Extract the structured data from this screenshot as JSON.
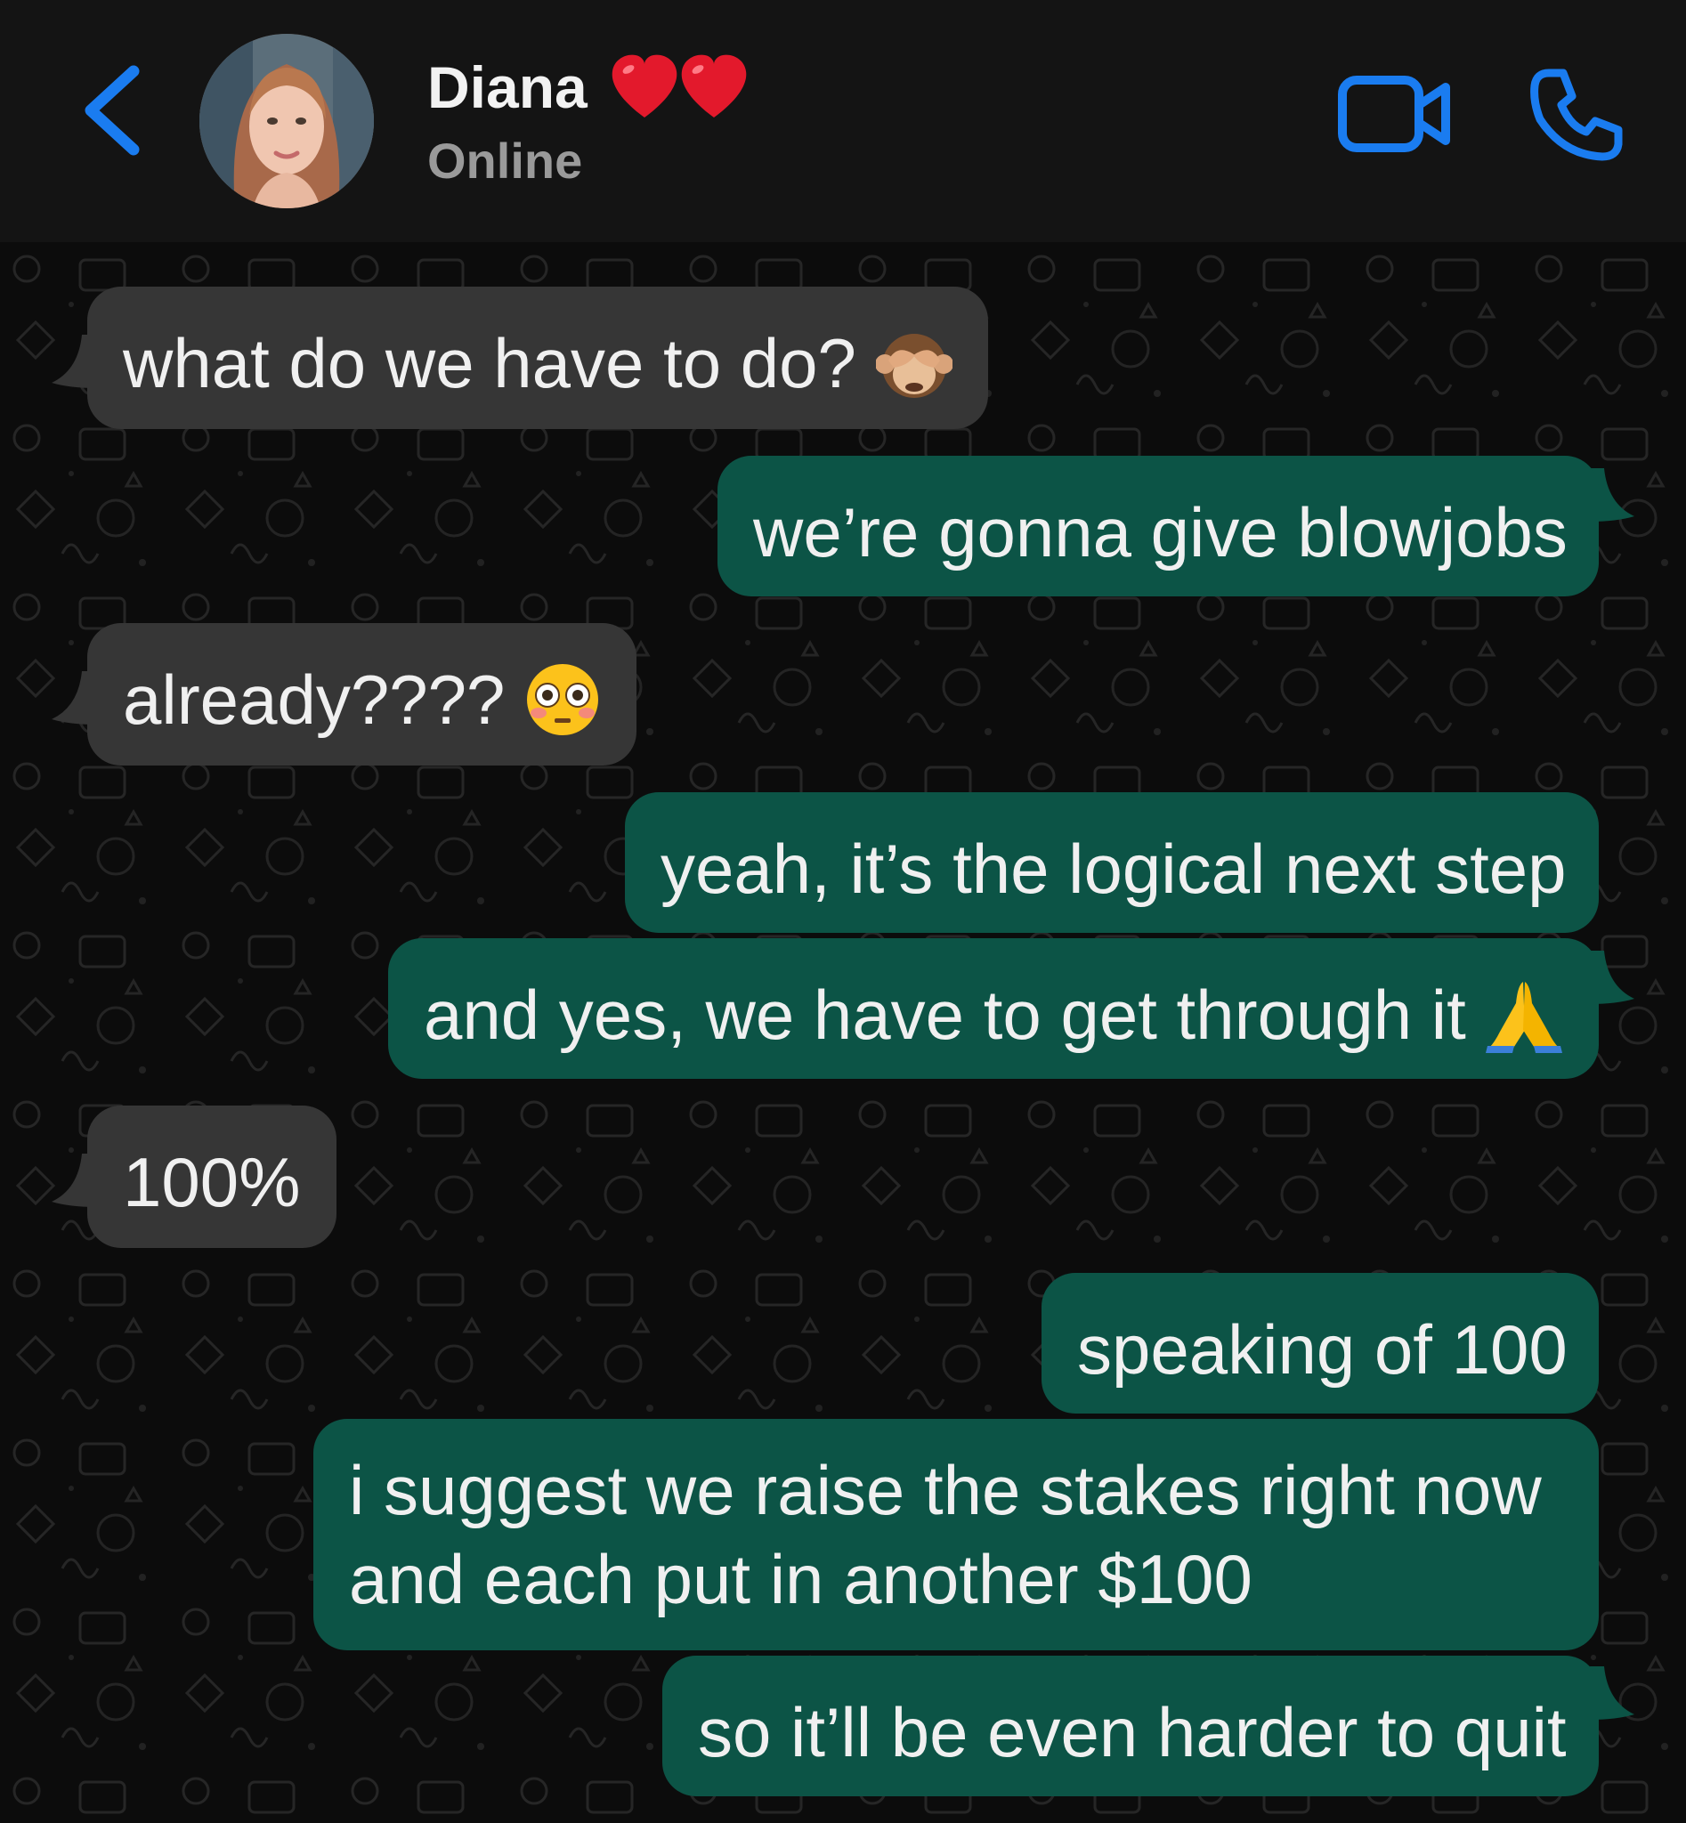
{
  "header": {
    "back_icon": "chevron-left-icon",
    "contact_name": "Diana",
    "name_emoji": "❤️❤️",
    "status": "Online",
    "video_icon": "video-camera-icon",
    "call_icon": "phone-icon",
    "accent_color": "#1a7cf0"
  },
  "messages": [
    {
      "dir": "in",
      "text": "what do we have to do?",
      "emoji": "see-no-evil-monkey"
    },
    {
      "dir": "out",
      "text": "we’re gonna give blowjobs"
    },
    {
      "dir": "in",
      "text": "already????",
      "emoji": "flushed-face"
    },
    {
      "dir": "out",
      "text": "yeah, it’s the logical next step"
    },
    {
      "dir": "out",
      "text": "and yes, we have to get through it",
      "emoji": "folded-hands"
    },
    {
      "dir": "in",
      "text": "100%"
    },
    {
      "dir": "out",
      "text": "speaking of 100"
    },
    {
      "dir": "out",
      "lines": [
        "i suggest we raise the stakes right now",
        "and each put in another $100"
      ]
    },
    {
      "dir": "out",
      "text": "so it’ll be even harder to quit"
    }
  ],
  "colors": {
    "incoming_bubble": "#363636",
    "outgoing_bubble": "#0c5446",
    "background": "#0c0c0c"
  }
}
